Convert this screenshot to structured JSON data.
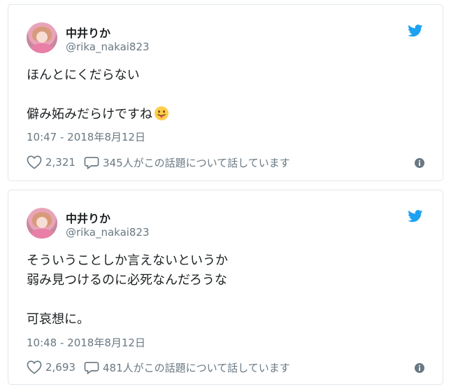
{
  "tweets": [
    {
      "author_name": "中井りか",
      "handle": "@rika_nakai823",
      "lines": [
        "ほんとにくだらない",
        "",
        "僻み妬みだらけですね"
      ],
      "emoji": "face-with-tongue-icon",
      "timestamp": "10:47 - 2018年8月12日",
      "likes": "2,321",
      "reply_text": "345人がこの話題について話しています"
    },
    {
      "author_name": "中井りか",
      "handle": "@rika_nakai823",
      "lines": [
        "そういうことしか言えないというか",
        "弱み見つけるのに必死なんだろうな",
        "",
        "可哀想に。"
      ],
      "timestamp": "10:48 - 2018年8月12日",
      "likes": "2,693",
      "reply_text": "481人がこの話題について話しています"
    }
  ],
  "colors": {
    "twitter_blue": "#1da1f2",
    "text": "#1c2022",
    "muted": "#697882",
    "border": "#e1e8ed"
  }
}
